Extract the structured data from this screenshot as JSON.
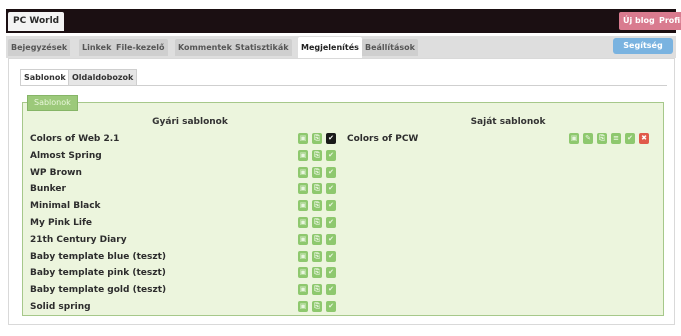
{
  "app": {
    "title": "PC World",
    "top_buttons": [
      "Új blog",
      "Profil"
    ]
  },
  "nav": {
    "tabs": [
      {
        "label": "Bejegyzések"
      },
      {
        "label": "Linkek"
      },
      {
        "label": "File-kezelő"
      },
      {
        "label": "Kommentek"
      },
      {
        "label": "Statisztikák"
      },
      {
        "label": "Megjelenítés"
      },
      {
        "label": "Beállítások"
      }
    ],
    "active": "Megjelenítés",
    "help_label": "Segítség"
  },
  "subtabs": {
    "items": [
      "Sablonok",
      "Oldaldobozok"
    ],
    "active": "Sablonok"
  },
  "section": {
    "legend": "Sablonok",
    "factory_title": "Gyári sablonok",
    "own_title": "Saját sablonok"
  },
  "factory_templates": [
    {
      "name": "Colors of Web 2.1",
      "selected": true
    },
    {
      "name": "Almost Spring",
      "selected": false
    },
    {
      "name": "WP Brown",
      "selected": false
    },
    {
      "name": "Bunker",
      "selected": false
    },
    {
      "name": "Minimal Black",
      "selected": false
    },
    {
      "name": "My Pink Life",
      "selected": false
    },
    {
      "name": "21th Century Diary",
      "selected": false
    },
    {
      "name": "Baby template blue (teszt)",
      "selected": false
    },
    {
      "name": "Baby template pink (teszt)",
      "selected": false
    },
    {
      "name": "Baby template gold (teszt)",
      "selected": false
    },
    {
      "name": "Solid spring",
      "selected": false
    }
  ],
  "own_templates": [
    {
      "name": "Colors of PCW"
    }
  ],
  "colors": {
    "accent_green": "#8ec86e",
    "panel_green": "#ecf5dd",
    "topbar": "#1b0f12",
    "delete_red": "#e05a4a"
  },
  "icons": {
    "factory_row": [
      "preview-icon",
      "copy-icon",
      "activate-check-icon"
    ],
    "own_row": [
      "preview-icon",
      "edit-icon",
      "copy-icon",
      "settings-icon",
      "activate-check-icon",
      "delete-icon"
    ]
  }
}
